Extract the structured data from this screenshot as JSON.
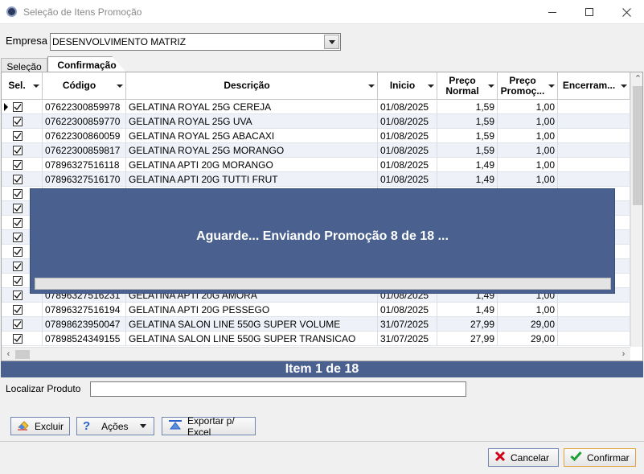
{
  "window": {
    "title": "Seleção de Itens Promoção"
  },
  "empresa": {
    "label": "Empresa",
    "value": "DESENVOLVIMENTO MATRIZ"
  },
  "tabs": [
    {
      "label": "Seleção"
    },
    {
      "label": "Confirmação"
    }
  ],
  "grid": {
    "headers": [
      "Sel.",
      "Código",
      "Descrição",
      "Inicio",
      "Preço Normal",
      "Preço Promoç...",
      "Encerram..."
    ],
    "rows": [
      {
        "codigo": "07622300859978",
        "descricao": "GELATINA ROYAL 25G CEREJA",
        "inicio": "01/08/2025",
        "preco_normal": "1,59",
        "preco_promo": "1,00"
      },
      {
        "codigo": "07622300859770",
        "descricao": "GELATINA ROYAL 25G UVA",
        "inicio": "01/08/2025",
        "preco_normal": "1,59",
        "preco_promo": "1,00"
      },
      {
        "codigo": "07622300860059",
        "descricao": "GELATINA ROYAL 25G ABACAXI",
        "inicio": "01/08/2025",
        "preco_normal": "1,59",
        "preco_promo": "1,00"
      },
      {
        "codigo": "07622300859817",
        "descricao": "GELATINA ROYAL 25G MORANGO",
        "inicio": "01/08/2025",
        "preco_normal": "1,59",
        "preco_promo": "1,00"
      },
      {
        "codigo": "07896327516118",
        "descricao": "GELATINA APTI 20G MORANGO",
        "inicio": "01/08/2025",
        "preco_normal": "1,49",
        "preco_promo": "1,00"
      },
      {
        "codigo": "07896327516170",
        "descricao": "GELATINA APTI 20G TUTTI FRUT",
        "inicio": "01/08/2025",
        "preco_normal": "1,49",
        "preco_promo": "1,00"
      },
      {
        "codigo": "",
        "descricao": "",
        "inicio": "",
        "preco_normal": "",
        "preco_promo": ""
      },
      {
        "codigo": "",
        "descricao": "",
        "inicio": "",
        "preco_normal": "",
        "preco_promo": ""
      },
      {
        "codigo": "",
        "descricao": "",
        "inicio": "",
        "preco_normal": "",
        "preco_promo": ""
      },
      {
        "codigo": "",
        "descricao": "",
        "inicio": "",
        "preco_normal": "",
        "preco_promo": ""
      },
      {
        "codigo": "",
        "descricao": "",
        "inicio": "",
        "preco_normal": "",
        "preco_promo": ""
      },
      {
        "codigo": "",
        "descricao": "",
        "inicio": "",
        "preco_normal": "",
        "preco_promo": ""
      },
      {
        "codigo": "",
        "descricao": "",
        "inicio": "",
        "preco_normal": "",
        "preco_promo": ""
      },
      {
        "codigo": "07896327516231",
        "descricao": "GELATINA APTI 20G AMORA",
        "inicio": "01/08/2025",
        "preco_normal": "1,49",
        "preco_promo": "1,00"
      },
      {
        "codigo": "07896327516194",
        "descricao": "GELATINA APTI 20G PESSEGO",
        "inicio": "01/08/2025",
        "preco_normal": "1,49",
        "preco_promo": "1,00"
      },
      {
        "codigo": "07898623950047",
        "descricao": "GELATINA SALON LINE 550G SUPER VOLUME",
        "inicio": "31/07/2025",
        "preco_normal": "27,99",
        "preco_promo": "29,00"
      },
      {
        "codigo": "07898524349155",
        "descricao": "GELATINA SALON LINE 550G SUPER TRANSICAO",
        "inicio": "31/07/2025",
        "preco_normal": "27,99",
        "preco_promo": "29,00"
      }
    ]
  },
  "overlay": {
    "message": "Aguarde... Enviando Promoção 8 de 18 ..."
  },
  "status": {
    "item_text": "Item 1 de 18"
  },
  "search": {
    "label": "Localizar Produto",
    "value": ""
  },
  "buttons": {
    "excluir": "Excluir",
    "acoes": "Ações",
    "exportar": "Exportar p/ Excel",
    "cancelar": "Cancelar",
    "confirmar": "Confirmar"
  },
  "colors": {
    "accent": "#4a6190",
    "confirm_border": "#e3a33a"
  }
}
